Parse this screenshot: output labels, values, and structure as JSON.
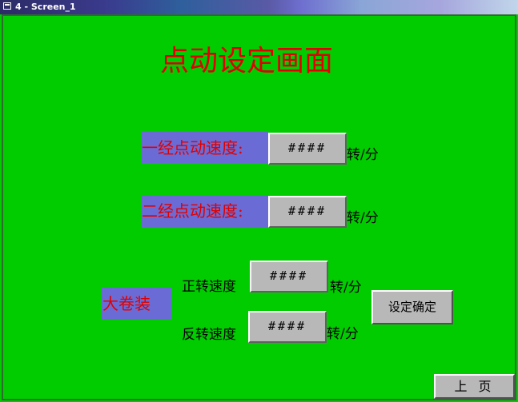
{
  "window": {
    "title": "4 - Screen_1"
  },
  "screen": {
    "title": "点动设定画面"
  },
  "jog_speed_1": {
    "label": "一经点动速度:",
    "value": "####",
    "unit": "转/分"
  },
  "jog_speed_2": {
    "label": "二经点动速度:",
    "value": "####",
    "unit": "转/分"
  },
  "big_roll": {
    "label": "大卷装",
    "forward": {
      "label": "正转速度",
      "value": "####",
      "unit": "转/分"
    },
    "reverse": {
      "label": "反转速度",
      "value": "####",
      "unit": "转/分"
    },
    "confirm_label": "设定确定"
  },
  "nav": {
    "prev_label": "上页"
  },
  "colors": {
    "background": "#00cc00",
    "title": "#e00000",
    "label_box": "#6b6bd6",
    "field": "#b8b8b8"
  }
}
